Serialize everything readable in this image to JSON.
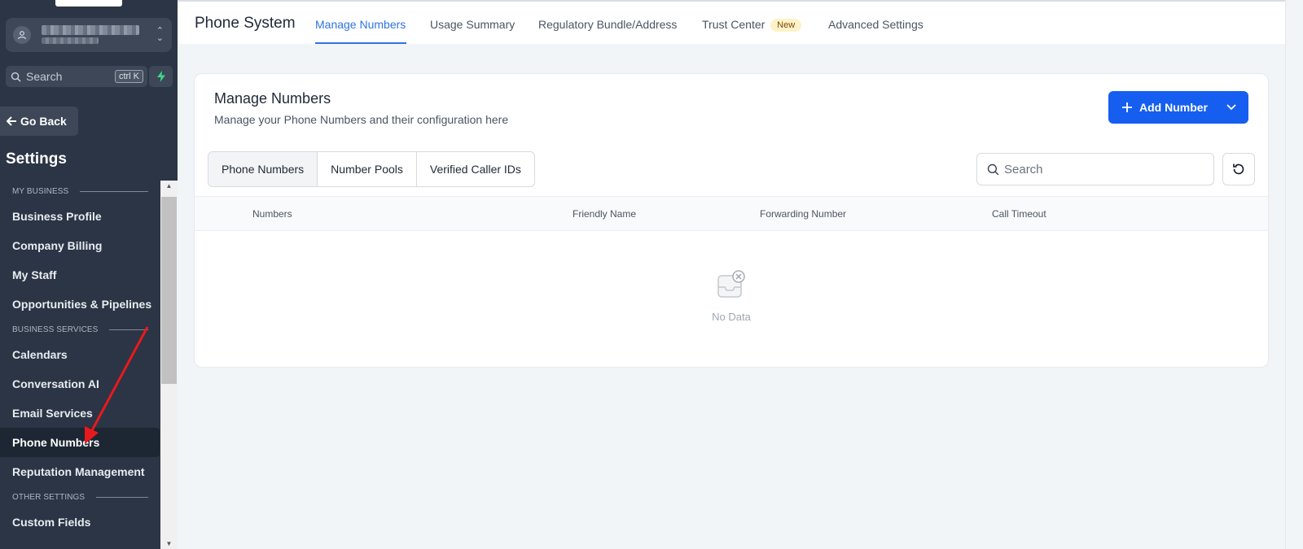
{
  "sidebar": {
    "search_placeholder": "Search",
    "search_shortcut": "ctrl K",
    "go_back": "Go Back",
    "settings_title": "Settings",
    "sections": [
      {
        "title": "MY BUSINESS",
        "items": [
          "Business Profile",
          "Company Billing",
          "My Staff",
          "Opportunities & Pipelines"
        ]
      },
      {
        "title": "BUSINESS SERVICES",
        "items": [
          "Calendars",
          "Conversation AI",
          "Email Services",
          "Phone Numbers",
          "Reputation Management"
        ]
      },
      {
        "title": "OTHER SETTINGS",
        "items": [
          "Custom Fields"
        ]
      }
    ],
    "active_item": "Phone Numbers"
  },
  "header": {
    "title": "Phone System",
    "tabs": [
      {
        "label": "Manage Numbers",
        "active": true
      },
      {
        "label": "Usage Summary",
        "active": false
      },
      {
        "label": "Regulatory Bundle/Address",
        "active": false
      },
      {
        "label": "Trust Center",
        "active": false,
        "badge": "New"
      },
      {
        "label": "Advanced Settings",
        "active": false
      }
    ]
  },
  "card": {
    "title": "Manage Numbers",
    "subtitle": "Manage your Phone Numbers and their configuration here",
    "add_button": "Add Number",
    "segments": [
      {
        "label": "Phone Numbers",
        "active": true
      },
      {
        "label": "Number Pools",
        "active": false
      },
      {
        "label": "Verified Caller IDs",
        "active": false
      }
    ],
    "search_placeholder": "Search",
    "columns": [
      "Numbers",
      "Friendly Name",
      "Forwarding Number",
      "Call Timeout"
    ],
    "empty_text": "No Data"
  },
  "colors": {
    "sidebar_bg": "#2b3545",
    "accent": "#155eef",
    "tab_active": "#2f74e0",
    "annotation_arrow": "#e8191d"
  },
  "icons": [
    "user-icon",
    "chevron-updown-icon",
    "search-icon",
    "bolt-icon",
    "arrow-left-icon",
    "plus-icon",
    "chevron-down-icon",
    "refresh-icon",
    "empty-inbox-icon"
  ]
}
